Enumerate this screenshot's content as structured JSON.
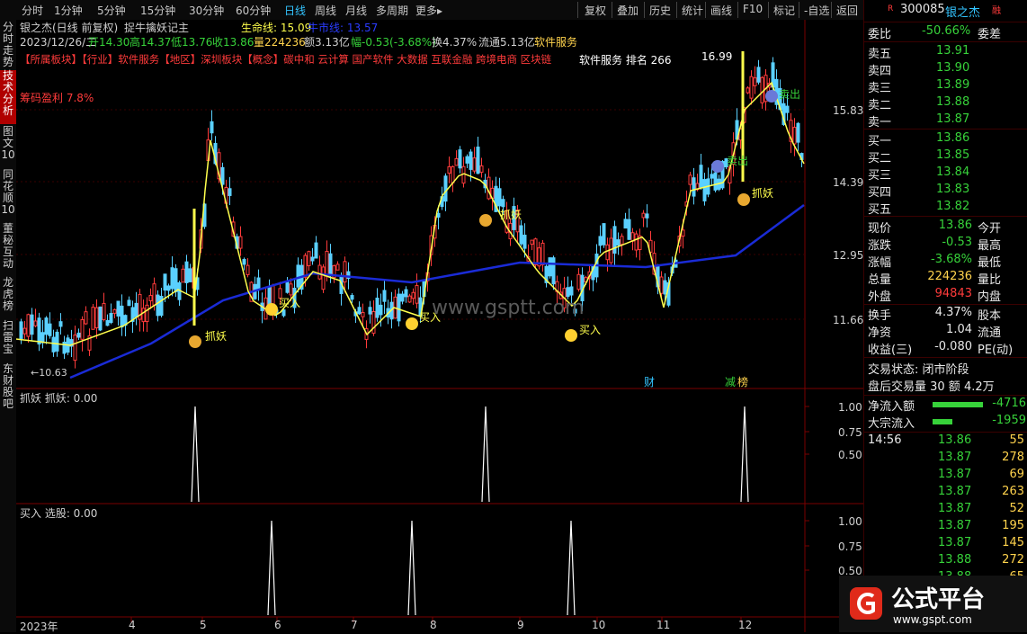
{
  "toolbar": {
    "periods": [
      "分时",
      "1分钟",
      "5分钟",
      "15分钟",
      "30分钟",
      "60分钟",
      "日线",
      "周线",
      "月线",
      "多周期",
      "更多▸"
    ],
    "active_period": "日线",
    "right_buttons": [
      "复权",
      "叠加",
      "历史",
      "统计",
      "画线",
      "F10",
      "标记",
      "-自选",
      "返回"
    ]
  },
  "left_tabs": [
    "分时走势",
    "技术分析",
    "图文10",
    "同花顺10",
    "董秘互动",
    "龙虎榜",
    "扫雷宝",
    "东财股吧"
  ],
  "header": {
    "stock_line": "银之杰(日线 前复权)",
    "indicator_name": "捉牛擒妖记主",
    "life_line_label": "生命线: 15.09",
    "extra_label": "牛市线: 13.57",
    "date": "2023/12/26/二",
    "open": "开14.30",
    "high": "高14.37",
    "low": "低13.76",
    "close": "收13.86",
    "volume": "量224236",
    "amount": "额3.13亿",
    "change": "幅-0.53(-3.68%)",
    "turnover": "换4.37%",
    "float": "流通5.13亿",
    "industry": "软件服务",
    "concepts": "【所属板块】【行业】软件服务【地区】深圳板块【概念】碳中和 云计算 国产软件 大数据 互联金融 跨境电商 区块链",
    "rank_text": "软件服务 排名 266",
    "profit_text": "筹码盈利 7.8%"
  },
  "price_axis": [
    "15.83",
    "14.39",
    "12.95",
    "11.66"
  ],
  "volume_axis": [
    "1.00",
    "0.75",
    "0.50"
  ],
  "annotations": {
    "high_label": "16.99",
    "low_label": "←10.63",
    "buy": "买入",
    "catch": "抓妖",
    "sell": "卖出",
    "cai": "财",
    "jian": "减",
    "bang": "榜"
  },
  "sub1": {
    "title": "抓妖 抓妖: 0.00"
  },
  "sub2": {
    "title": "买入 选股: 0.00"
  },
  "x_axis": [
    "2023年",
    "4",
    "5",
    "6",
    "7",
    "8",
    "9",
    "10",
    "11",
    "12"
  ],
  "watermark": "www.gsptt.com",
  "right_panel": {
    "code": "300085",
    "name": "银之杰",
    "flag": "R",
    "small": "融",
    "wei_bi_label": "委比",
    "wei_bi": "-50.66%",
    "wei_cha_label": "委差",
    "asks": [
      {
        "label": "卖五",
        "price": "13.91"
      },
      {
        "label": "卖四",
        "price": "13.90"
      },
      {
        "label": "卖三",
        "price": "13.89"
      },
      {
        "label": "卖二",
        "price": "13.88"
      },
      {
        "label": "卖一",
        "price": "13.87"
      }
    ],
    "bids": [
      {
        "label": "买一",
        "price": "13.86"
      },
      {
        "label": "买二",
        "price": "13.85"
      },
      {
        "label": "买三",
        "price": "13.84"
      },
      {
        "label": "买四",
        "price": "13.83"
      },
      {
        "label": "买五",
        "price": "13.82"
      }
    ],
    "stats": [
      {
        "l": "现价",
        "v": "13.86",
        "r": "今开"
      },
      {
        "l": "涨跌",
        "v": "-0.53",
        "r": "最高"
      },
      {
        "l": "涨幅",
        "v": "-3.68%",
        "r": "最低"
      },
      {
        "l": "总量",
        "v": "224236",
        "r": "量比"
      },
      {
        "l": "外盘",
        "v": "94843",
        "r": "内盘"
      }
    ],
    "stats2": [
      {
        "l": "换手",
        "v": "4.37%",
        "r": "股本"
      },
      {
        "l": "净资",
        "v": "1.04",
        "r": "流通"
      },
      {
        "l": "收益(三)",
        "v": "-0.080",
        "r": "PE(动)"
      }
    ],
    "trade_status": "交易状态: 闭市阶段",
    "after_hours": "盘后交易量 30 额 4.2万",
    "net_inflow_label": "净流入额",
    "net_inflow": "-4716",
    "block_inflow_label": "大宗流入",
    "block_inflow": "-1959",
    "ticks": [
      {
        "t": "14:56",
        "p": "13.86",
        "v": "55"
      },
      {
        "t": "",
        "p": "13.87",
        "v": "278"
      },
      {
        "t": "",
        "p": "13.87",
        "v": "69"
      },
      {
        "t": "",
        "p": "13.87",
        "v": "263"
      },
      {
        "t": "",
        "p": "13.87",
        "v": "52"
      },
      {
        "t": "",
        "p": "13.87",
        "v": "195"
      },
      {
        "t": "",
        "p": "13.87",
        "v": "145"
      },
      {
        "t": "",
        "p": "13.88",
        "v": "272"
      },
      {
        "t": "",
        "p": "13.88",
        "v": "65"
      }
    ]
  },
  "logo": {
    "text": "公式平台",
    "url": "www.gspt.com"
  }
}
